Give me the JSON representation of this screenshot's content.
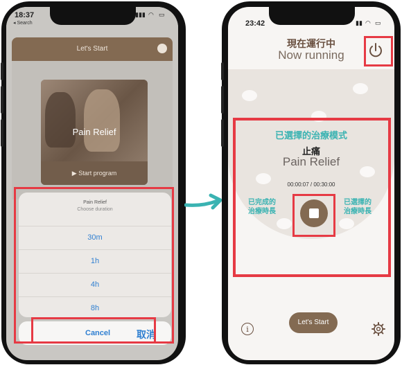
{
  "left_phone": {
    "status_time": "18:37",
    "back_label": "◂ Search",
    "header_title": "Let's Start",
    "program": {
      "title": "Pain Relief",
      "start_label": "▶ Start program"
    },
    "sheet": {
      "title": "Pain Relief",
      "subtitle": "Choose duration",
      "options": [
        "30m",
        "1h",
        "4h",
        "8h"
      ],
      "cancel_en": "Cancel",
      "cancel_zh": "取消"
    }
  },
  "right_phone": {
    "status_time": "23:42",
    "running_zh": "現在運行中",
    "running_en": "Now running",
    "selected_mode": "已選擇的治療模式",
    "mode_zh": "止痛",
    "mode_en": "Pain Relief",
    "elapsed": "00:00:07",
    "separator": "/",
    "total": "00:30:00",
    "completed_label": "已完成的\n治療時長",
    "selected_label": "已選擇的\n治療時長",
    "lets_start": "Let's Start"
  },
  "colors": {
    "accent": "#836a52",
    "teal": "#3ab3b2",
    "highlight": "#e63a44",
    "arrow": "#3ab3b2"
  },
  "icons": [
    "power-icon",
    "info-icon",
    "gear-icon",
    "stop-icon",
    "moon-icon",
    "arrow-right-icon"
  ]
}
